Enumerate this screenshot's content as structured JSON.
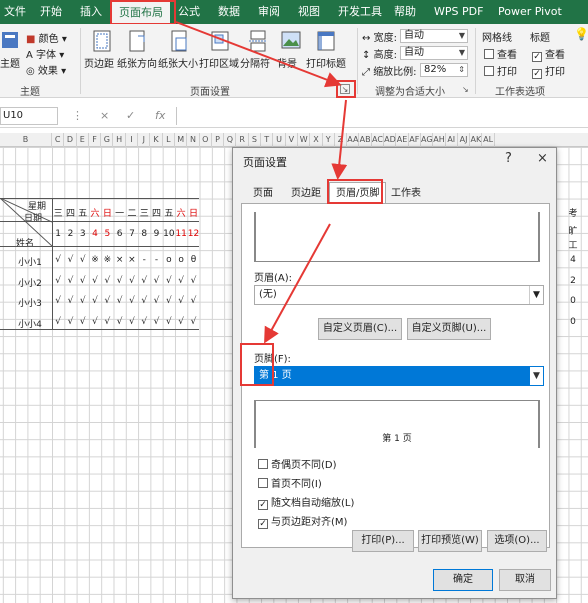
{
  "ribbon": {
    "tabs": [
      "文件",
      "开始",
      "插入",
      "页面布局",
      "公式",
      "数据",
      "审阅",
      "视图",
      "开发工具",
      "帮助",
      "WPS PDF",
      "Power Pivot"
    ],
    "theme_labels": [
      "主题",
      "颜色",
      "字体",
      "效果"
    ],
    "buttons": [
      "页边距",
      "纸张方向",
      "纸张大小",
      "打印区域",
      "分隔符",
      "背景",
      "打印标题"
    ],
    "scale": {
      "width_label": "宽度:",
      "width_value": "自动",
      "height_label": "高度:",
      "height_value": "自动",
      "zoom_label": "缩放比例:",
      "zoom_value": "82%"
    },
    "sheet_options": {
      "gridlines": "网格线",
      "headings": "标题",
      "view": "查看",
      "print": "打印"
    },
    "groups": [
      "主题",
      "页面设置",
      "调整为合适大小",
      "工作表选项"
    ]
  },
  "formula_bar": {
    "name_box": "U10",
    "cancel": "×",
    "enter": "✓",
    "fx": "fx"
  },
  "sheet": {
    "columns": [
      "B",
      "C",
      "D",
      "E",
      "F",
      "G",
      "H",
      "I",
      "J",
      "K",
      "L",
      "M",
      "N",
      "O",
      "P",
      "Q",
      "R",
      "S",
      "T",
      "U",
      "V",
      "W",
      "X",
      "Y",
      "Z",
      "AA",
      "AB",
      "AC",
      "AD",
      "AE",
      "AF",
      "AG",
      "AH",
      "AI",
      "AJ",
      "AK",
      "AL"
    ],
    "header_week": "星期",
    "header_date": "日期",
    "header_name": "姓名",
    "weekdays": [
      "三",
      "四",
      "五",
      "六",
      "日",
      "一",
      "二",
      "三",
      "四",
      "五",
      "六",
      "日"
    ],
    "dates": [
      "1",
      "2",
      "3",
      "4",
      "5",
      "6",
      "7",
      "8",
      "9",
      "10",
      "11",
      "12"
    ],
    "rows": [
      {
        "name": "小小1",
        "marks": [
          "√",
          "√",
          "√",
          "※",
          "※",
          "×",
          "×",
          "-",
          "-",
          "o",
          "o",
          "θ"
        ],
        "right": "4"
      },
      {
        "name": "小小2",
        "marks": [
          "√",
          "√",
          "√",
          "√",
          "√",
          "√",
          "√",
          "√",
          "√",
          "√",
          "√",
          "√"
        ],
        "right": "2"
      },
      {
        "name": "小小3",
        "marks": [
          "√",
          "√",
          "√",
          "√",
          "√",
          "√",
          "√",
          "√",
          "√",
          "√",
          "√",
          "√"
        ],
        "right": "0"
      },
      {
        "name": "小小4",
        "marks": [
          "√",
          "√",
          "√",
          "√",
          "√",
          "√",
          "√",
          "√",
          "√",
          "√",
          "√",
          "√"
        ],
        "right": "0"
      }
    ],
    "right_header_top": "考",
    "right_header_a": "旷",
    "right_header_b": "工"
  },
  "dialog": {
    "title": "页面设置",
    "help": "?",
    "close": "×",
    "tabs": [
      "页面",
      "页边距",
      "页眉/页脚",
      "工作表"
    ],
    "header_label": "页眉(A):",
    "header_value": "(无)",
    "custom_header": "自定义页眉(C)...",
    "custom_footer": "自定义页脚(U)...",
    "footer_label": "页脚(F):",
    "footer_value": "第 1 页",
    "footer_preview": "第 1 页",
    "checkboxes": [
      {
        "label": "奇偶页不同(D)",
        "checked": false
      },
      {
        "label": "首页不同(I)",
        "checked": false
      },
      {
        "label": "随文档自动缩放(L)",
        "checked": true
      },
      {
        "label": "与页边距对齐(M)",
        "checked": true
      }
    ],
    "print_btn": "打印(P)...",
    "preview_btn": "打印预览(W)",
    "options_btn": "选项(O)...",
    "ok_btn": "确定",
    "cancel_btn": "取消"
  },
  "colors": {
    "excel_green": "#217346",
    "annotation_red": "#e53935",
    "selection_blue": "#0078d7"
  }
}
